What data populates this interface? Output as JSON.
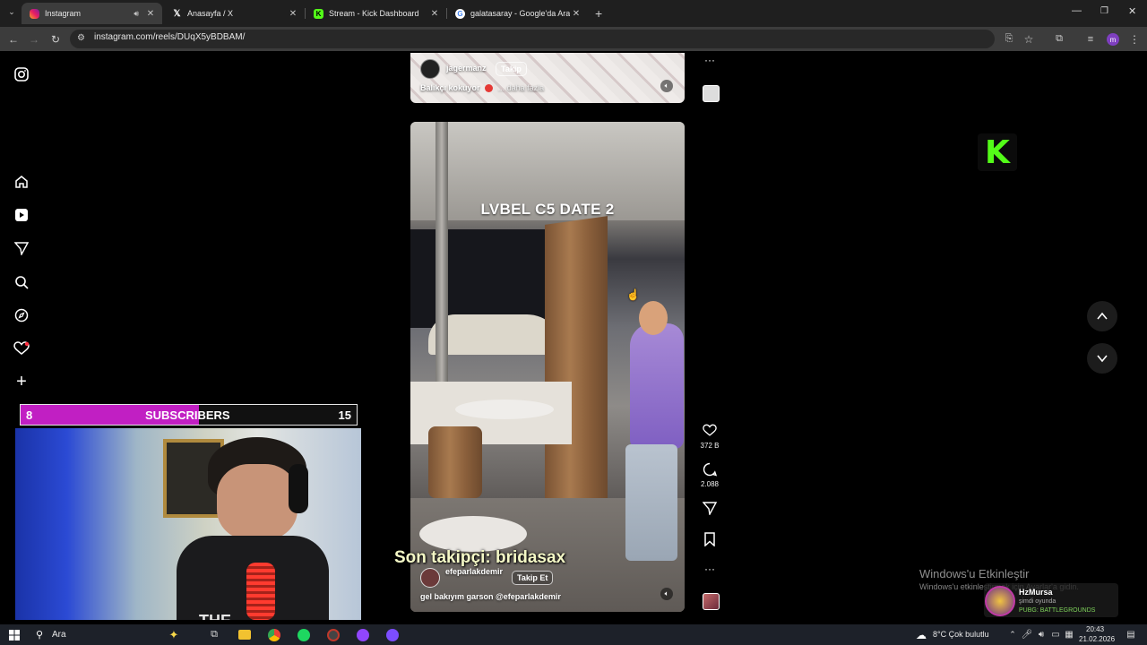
{
  "browser": {
    "tabs": [
      {
        "title": "Instagram",
        "icon": "instagram-icon",
        "active": true,
        "audio": true
      },
      {
        "title": "Anasayfa / X",
        "icon": "x-icon",
        "active": false
      },
      {
        "title": "Stream - Kick Dashboard",
        "icon": "kick-icon",
        "active": false
      },
      {
        "title": "galatasaray - Google'da Ara",
        "icon": "google-icon",
        "active": false
      }
    ],
    "url": "instagram.com/reels/DUqX5yBDBAM/",
    "profile_initial": "m"
  },
  "reel_top": {
    "username": "jagermanz",
    "follow_label": "Takip",
    "caption": "Balıkçı kokuyor",
    "caption_more": "... daha fazla"
  },
  "reel_main": {
    "overlay_title": "LVBEL C5 DATE 2",
    "username": "efeparlakdemir",
    "follow_label": "Takip Et",
    "caption": "gel bakıyım garson @efeparlakdemir",
    "likes": "372 B",
    "comments": "2.088"
  },
  "stream_overlay": {
    "sub_current": "8",
    "sub_label": "SUBSCRIBERS",
    "sub_goal": "15",
    "sub_progress": 0.53,
    "last_follower": "Son takipçi: bridasax",
    "kick_logo": "K"
  },
  "windows_activation": {
    "title": "Windows'u Etkinleştir",
    "subtitle": "Windows'u etkinleştirmek için Ayarlar'a gidin."
  },
  "notification": {
    "name": "HzMursa",
    "status": "şimdi oyunda",
    "game": "PUBG: BATTLEGROUNDS"
  },
  "taskbar": {
    "search_label": "Ara",
    "weather": "8°C  Çok bulutlu",
    "time": "20:43",
    "date": "21.02.2026"
  },
  "colors": {
    "kick_green": "#53fc18",
    "sub_bar": "#c11fc3",
    "notif_badge": "#ff3040"
  }
}
